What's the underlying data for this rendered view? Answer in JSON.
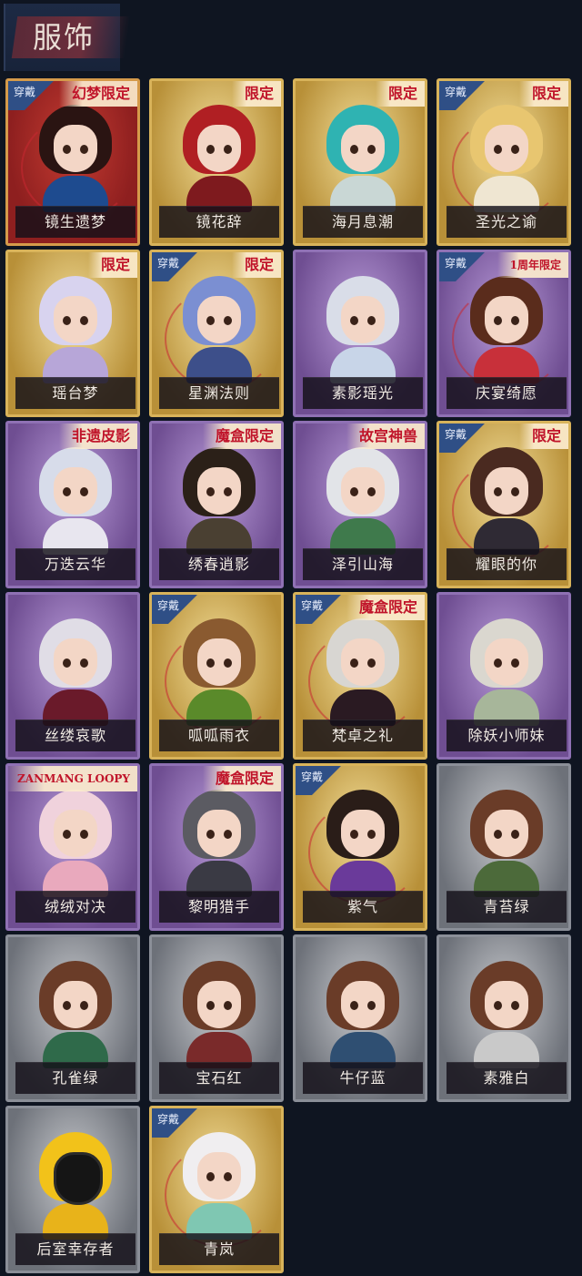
{
  "header": {
    "title": "服饰"
  },
  "cards": [
    {
      "name": "镜生遗梦",
      "frame": "red",
      "worn": true,
      "tag": "幻梦限定",
      "hair": "#2a1412",
      "body": "#1e4b8f"
    },
    {
      "name": "镜花辞",
      "frame": "gold",
      "worn": false,
      "tag": "限定",
      "hair": "#b01f23",
      "body": "#7e1a1e"
    },
    {
      "name": "海月息潮",
      "frame": "gold",
      "worn": false,
      "tag": "限定",
      "hair": "#2fb3b2",
      "body": "#c9d7d5"
    },
    {
      "name": "圣光之谕",
      "frame": "gold",
      "worn": true,
      "tag": "限定",
      "hair": "#e8c670",
      "body": "#efe6d2"
    },
    {
      "name": "瑶台梦",
      "frame": "gold",
      "worn": false,
      "tag": "限定",
      "hair": "#d8d3ef",
      "body": "#b7a6d8"
    },
    {
      "name": "星渊法则",
      "frame": "gold",
      "worn": true,
      "tag": "限定",
      "hair": "#7b8fd2",
      "body": "#3d4f8a"
    },
    {
      "name": "素影瑶光",
      "frame": "purple",
      "worn": false,
      "tag": "",
      "hair": "#d9dde8",
      "body": "#c8d5e8"
    },
    {
      "name": "庆宴绮愿",
      "frame": "purple",
      "worn": true,
      "tag": "1周年限定",
      "hair": "#5a2c1c",
      "body": "#c8303a"
    },
    {
      "name": "万迭云华",
      "frame": "purple",
      "worn": false,
      "tag": "非遗皮影",
      "hair": "#d7dcea",
      "body": "#e8e6ef"
    },
    {
      "name": "绣春逍影",
      "frame": "purple",
      "worn": false,
      "tag": "魔盒限定",
      "hair": "#2b2018",
      "body": "#4a4032"
    },
    {
      "name": "泽引山海",
      "frame": "purple",
      "worn": false,
      "tag": "故宫神兽",
      "hair": "#e2e4e8",
      "body": "#3f7a4c"
    },
    {
      "name": "耀眼的你",
      "frame": "gold",
      "worn": true,
      "tag": "限定",
      "hair": "#4a2a20",
      "body": "#2f2a34"
    },
    {
      "name": "丝缕哀歌",
      "frame": "purple",
      "worn": false,
      "tag": "",
      "hair": "#e0dde6",
      "body": "#6a1a2a"
    },
    {
      "name": "呱呱雨衣",
      "frame": "gold",
      "worn": true,
      "tag": "",
      "hair": "#8a5a30",
      "body": "#5a8a2a"
    },
    {
      "name": "梵卓之礼",
      "frame": "gold",
      "worn": true,
      "tag": "魔盒限定",
      "hair": "#d8d6d2",
      "body": "#2a1a22"
    },
    {
      "name": "除妖小师妹",
      "frame": "purple",
      "worn": false,
      "tag": "",
      "hair": "#dad7cf",
      "body": "#a7b69a"
    },
    {
      "name": "绒绒对决",
      "frame": "purple",
      "worn": false,
      "tag": "ZANMANG LOOPY",
      "hair": "#f0d2dc",
      "body": "#e9a9bd"
    },
    {
      "name": "黎明猎手",
      "frame": "purple",
      "worn": false,
      "tag": "魔盒限定",
      "hair": "#5b5b62",
      "body": "#3a3a44"
    },
    {
      "name": "紫气",
      "frame": "gold",
      "worn": true,
      "tag": "",
      "hair": "#2a1d18",
      "body": "#6a3a9a"
    },
    {
      "name": "青苔绿",
      "frame": "gray",
      "worn": false,
      "tag": "",
      "hair": "#6a3c28",
      "body": "#4c6a3a"
    },
    {
      "name": "孔雀绿",
      "frame": "gray",
      "worn": false,
      "tag": "",
      "hair": "#6a3c28",
      "body": "#2f6a4a"
    },
    {
      "name": "宝石红",
      "frame": "gray",
      "worn": false,
      "tag": "",
      "hair": "#6a3c28",
      "body": "#7a2a2a"
    },
    {
      "name": "牛仔蓝",
      "frame": "gray",
      "worn": false,
      "tag": "",
      "hair": "#6a3c28",
      "body": "#2f4f72"
    },
    {
      "name": "素雅白",
      "frame": "gray",
      "worn": false,
      "tag": "",
      "hair": "#6a3c28",
      "body": "#c9c9c9"
    },
    {
      "name": "后室幸存者",
      "frame": "gray",
      "worn": false,
      "tag": "",
      "hair": "#f2c21a",
      "body": "#e8b31a",
      "masked": true
    },
    {
      "name": "青岚",
      "frame": "gold",
      "worn": true,
      "tag": "",
      "hair": "#f0eef0",
      "body": "#7fc7b2"
    }
  ],
  "labels": {
    "worn": "穿戴"
  }
}
